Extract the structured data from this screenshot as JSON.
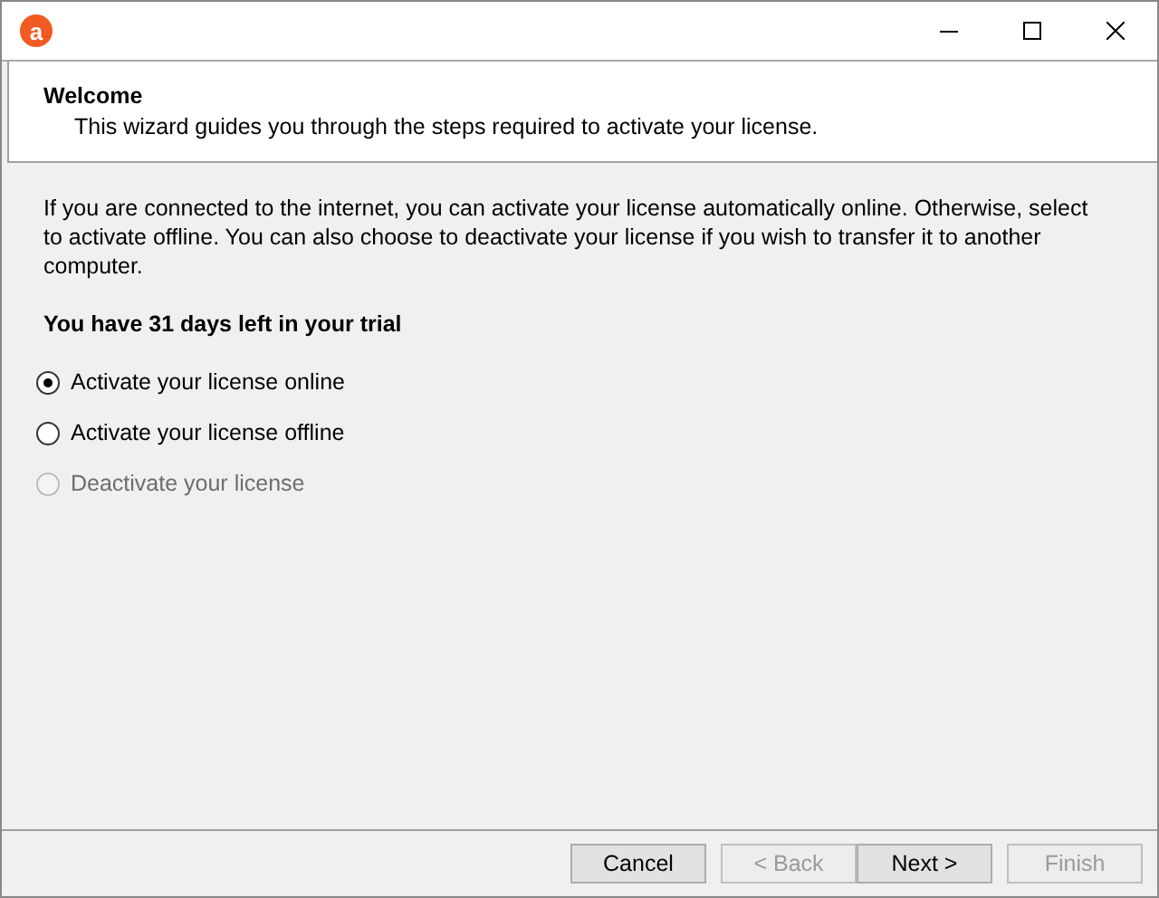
{
  "window": {
    "icon_letter": "a"
  },
  "header": {
    "title": "Welcome",
    "subtitle": "This wizard guides you through the steps required to activate your license."
  },
  "description": "If you are connected to the internet, you can activate your license automatically online. Otherwise, select to activate offline. You can also choose to deactivate your license if you wish to transfer it to another computer.",
  "trial_notice": "You have 31 days left in your trial",
  "options": [
    {
      "label": "Activate your license online",
      "selected": true,
      "disabled": false
    },
    {
      "label": "Activate your license offline",
      "selected": false,
      "disabled": false
    },
    {
      "label": "Deactivate your license",
      "selected": false,
      "disabled": true
    }
  ],
  "buttons": [
    {
      "label": "Cancel",
      "disabled": false
    },
    {
      "label": "< Back",
      "disabled": true
    },
    {
      "label": "Next >",
      "disabled": false
    },
    {
      "label": "Finish",
      "disabled": true
    }
  ]
}
